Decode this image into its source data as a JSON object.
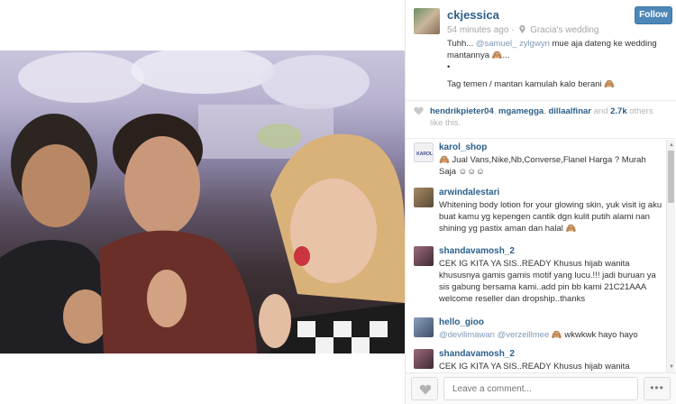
{
  "post": {
    "username": "ckjessica",
    "time_ago": "54 minutes ago",
    "separator": "·",
    "location": "Gracia's wedding",
    "follow_label": "Follow",
    "caption_pre": "Tuhh... ",
    "caption_mention1": "@samuel_",
    "caption_mention2": "zylgwyn",
    "caption_post": " mue aja dateng ke wedding mantannya 🙈...",
    "caption_bullet": "•",
    "caption_line2": "Tag temen / mantan kamulah kalo berani 🙈"
  },
  "likes": {
    "user1": "hendrikpieter04",
    "user2": "mgamegga",
    "user3": "dillaalfinar",
    "and_text": " and ",
    "count": "2.7k",
    "suffix": " others like this."
  },
  "comments": [
    {
      "user": "karol_shop",
      "text": "🙈 Jual Vans,Nike,Nb,Converse,Flanel Harga ? Murah Saja ☺☺☺",
      "avatar_color": "#f1f1f4"
    },
    {
      "user": "arwindalestari",
      "text": "Whitening body lotion for your glowing skin, yuk visit ig aku buat kamu yg kepengen cantik dgn kulit putih alami nan shining yg pastix aman dan halal 🙈",
      "avatar_color": "#7a6a4e"
    },
    {
      "user": "shandavamosh_2",
      "text": "CEK IG KITA YA SIS..READY Khusus hijab wanita khususnya gamis gamis motif yang lucu.!!! jadi buruan ya sis gabung bersama kami..add pin bb kami 21C21AAA welcome reseller dan dropship..thanks",
      "avatar_color": "#6b4a5a"
    },
    {
      "user": "hello_gioo",
      "mention1": "@devilimawan",
      "mention2": "@verzeillmee",
      "text": " 🙈 wkwkwk hayo hayo",
      "avatar_color": "#5b6f8a"
    },
    {
      "user": "shandavamosh_2",
      "text": "CEK IG KITA YA SIS..READY Khusus hijab wanita",
      "avatar_color": "#6b4a5a"
    }
  ],
  "footer": {
    "comment_placeholder": "Leave a comment...",
    "more_label": "•••"
  },
  "colors": {
    "link": "#2b5f8a",
    "follow_button": "#4d87b8",
    "mention": "#7c9ab8"
  },
  "icons": {
    "location": "map-pin-icon",
    "like": "heart-icon",
    "more": "ellipsis-icon"
  }
}
